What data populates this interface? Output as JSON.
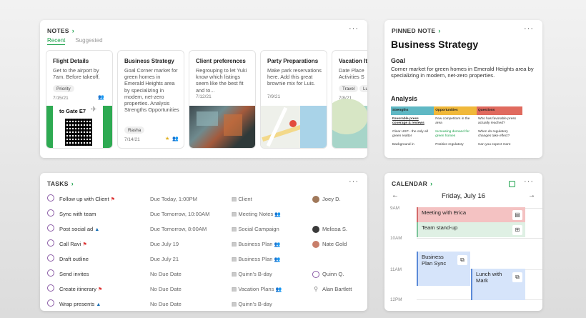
{
  "notes": {
    "title": "NOTES",
    "tabs": [
      "Recent",
      "Suggested"
    ],
    "cards": [
      {
        "title": "Flight Details",
        "body": "Get to the airport by 7am. Before takeoff,",
        "tag": "Priority",
        "date": "7/15/21",
        "image_text": "to Gate E7"
      },
      {
        "title": "Business Strategy",
        "body": "Goal Corner market for green homes in Emerald Heights area by specializing in modern, net-zero properties. Analysis Strengths Opportunities",
        "tag": "Rasha",
        "date": "7/14/21"
      },
      {
        "title": "Client preferences",
        "body": "Regrouping to let Yuki know which listings seem like the best fit and to...",
        "date": "7/12/21"
      },
      {
        "title": "Party Preparations",
        "body": "Make park reservations here. Add this great brownie mix for Luis.",
        "date": "7/9/21"
      },
      {
        "title": "Vacation Iti",
        "body": "Date Place Activities S",
        "tags": [
          "Travel",
          "Luis"
        ],
        "date": "7/8/21"
      }
    ]
  },
  "pinned": {
    "title": "PINNED NOTE",
    "heading": "Business Strategy",
    "goal_label": "Goal",
    "goal_body": "Corner market for green homes in Emerald Heights area by specializing in modern, net-zero properties.",
    "analysis_label": "Analysis",
    "table": {
      "headers": [
        "Strengths",
        "Opportunities",
        "Questions"
      ],
      "header_colors": [
        "#5fb8c4",
        "#f0b83a",
        "#e06a5e"
      ],
      "rows": [
        [
          "Favorable press coverage & reviews",
          "Few competitors in the area",
          "Who has favorable press actually reached?"
        ],
        [
          "Clear USP - the only all green realtor",
          "Increasing demand for green homes",
          "When do regulatory changes take effect?"
        ],
        [
          "Background in",
          "Positive regulatory",
          "Can you expect more"
        ]
      ]
    }
  },
  "tasks": {
    "title": "TASKS",
    "rows": [
      {
        "title": "Follow up with Client",
        "icon": "flag-icon",
        "due": "Due Today, 1:00PM",
        "project": "Client",
        "shared": false,
        "assignee": "Joey D.",
        "avatar": "#a0785a"
      },
      {
        "title": "Sync with team",
        "icon": "",
        "due": "Due Tomorrow, 10:00AM",
        "project": "Meeting Notes",
        "shared": true,
        "assignee": "",
        "avatar": ""
      },
      {
        "title": "Post social ad",
        "icon": "drop-icon",
        "due": "Due Tomorrow, 8:00AM",
        "project": "Social Campaign",
        "shared": false,
        "assignee": "Melissa S.",
        "avatar": "#3a3a3a"
      },
      {
        "title": "Call Ravi",
        "icon": "flag-icon",
        "due": "Due July 19",
        "project": "Business Plan",
        "shared": true,
        "assignee": "Nate Gold",
        "avatar": "#c87e6a"
      },
      {
        "title": "Draft outline",
        "icon": "",
        "due": "Due July 21",
        "project": "Business Plan",
        "shared": true,
        "assignee": "",
        "avatar": ""
      },
      {
        "title": "Send invites",
        "icon": "",
        "due": "No Due Date",
        "project": "Quinn's B-day",
        "shared": false,
        "assignee": "Quinn Q.",
        "avatar": "ring"
      },
      {
        "title": "Create itinerary",
        "icon": "flag-icon",
        "due": "No Due Date",
        "project": "Vacation Plans",
        "shared": true,
        "assignee": "Alan Bartlett",
        "avatar": "person"
      },
      {
        "title": "Wrap presents",
        "icon": "drop-icon",
        "due": "No Due Date",
        "project": "Quinn's B-day",
        "shared": false,
        "assignee": "",
        "avatar": ""
      }
    ]
  },
  "calendar": {
    "title": "CALENDAR",
    "day": "Friday, July 16",
    "hours": [
      "9AM",
      "10AM",
      "11AM",
      "12PM"
    ],
    "events": [
      {
        "title": "Meeting with Erica",
        "color": "#f4c2c2",
        "border": "#d46a6a"
      },
      {
        "title": "Team stand-up",
        "color": "#dff0e4",
        "border": "#7cc49a"
      },
      {
        "title": "Business Plan Sync",
        "color": "#d6e4fa",
        "border": "#5b8ad8"
      },
      {
        "title": "Lunch with Mark",
        "color": "#d6e4fa",
        "border": "#5b8ad8"
      }
    ]
  },
  "colors": {
    "accent": "#1aa14a",
    "checkbox": "#8a5aa6"
  }
}
